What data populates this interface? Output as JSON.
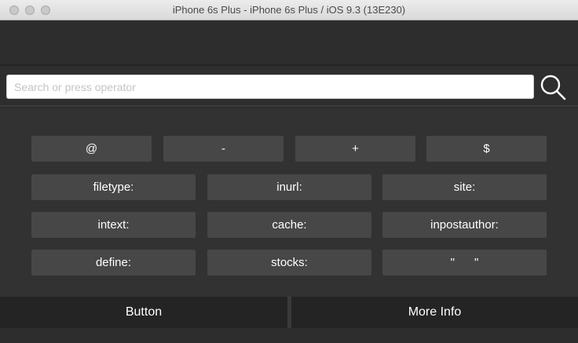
{
  "window": {
    "title": "iPhone 6s Plus - iPhone 6s Plus / iOS 9.3 (13E230)"
  },
  "search": {
    "placeholder": "Search or press operator",
    "value": ""
  },
  "keys": {
    "row1": [
      "@",
      "-",
      "+",
      "$"
    ],
    "row2": [
      "filetype:",
      "inurl:",
      "site:"
    ],
    "row3": [
      "intext:",
      "cache:",
      "inpostauthor:"
    ],
    "row4": [
      "define:",
      "stocks:",
      "\"      \""
    ]
  },
  "bottom": {
    "left_label": "Button",
    "right_label": "More Info"
  }
}
